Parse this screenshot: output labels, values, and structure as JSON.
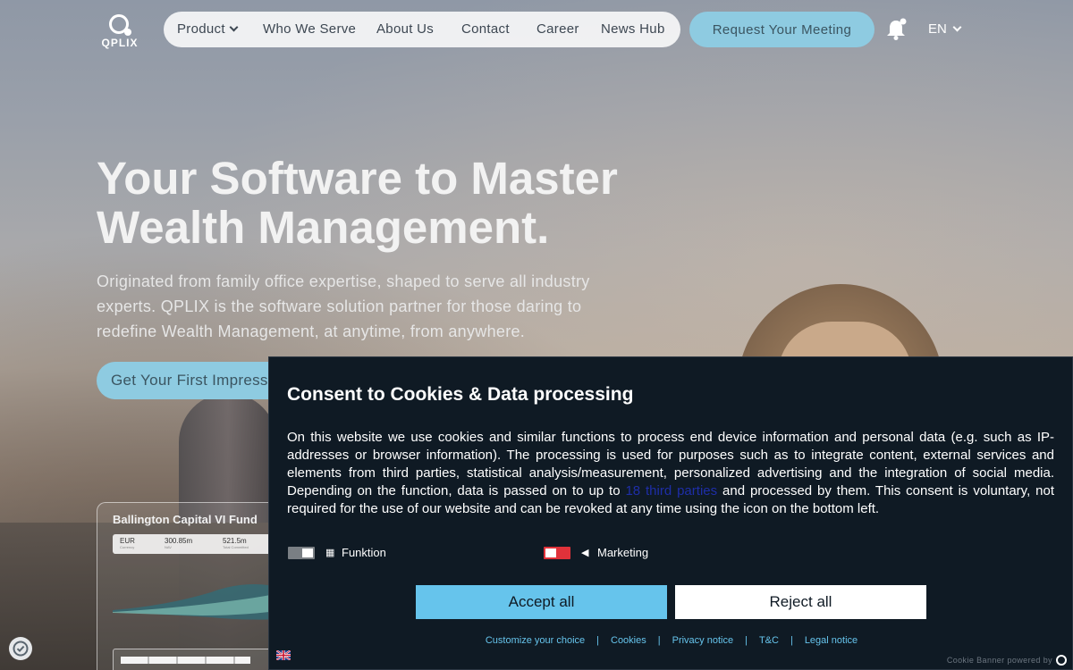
{
  "nav": {
    "logo_text": "QPLIX",
    "items": [
      {
        "label": "Product",
        "has_dropdown": true
      },
      {
        "label": "Who We Serve"
      },
      {
        "label": "About Us"
      },
      {
        "label": "Contact"
      },
      {
        "label": "Career"
      },
      {
        "label": "News Hub"
      }
    ],
    "meeting_button": "Request Your Meeting",
    "language": "EN"
  },
  "hero": {
    "title": "Your Software to Master Wealth Management.",
    "subtitle": "Originated from family office expertise, shaped to serve all industry experts. QPLIX is the software solution partner for those daring to redefine Wealth Management, at anytime, from anywhere.",
    "cta": "Get Your First Impression"
  },
  "fund_card": {
    "title": "Ballington Capital VI Fund",
    "stats": [
      {
        "value": "EUR",
        "label": "Currency"
      },
      {
        "value": "300.85m",
        "label": "NAV"
      },
      {
        "value": "521.5m",
        "label": "Total Committed"
      }
    ]
  },
  "cookie_banner": {
    "title": "Consent to Cookies & Data processing",
    "text_before_link": "On this website we use cookies and similar functions to process end device information and personal data (e.g. such as IP-addresses or browser information). The processing is used for purposes such as to integrate content, external services and elements from third parties, statistical analysis/measurement, personalized advertising and the integration of social media. Depending on the function, data is passed on to up to ",
    "link_text": "18 third parties",
    "text_after_link": " and processed by them. This consent is voluntary, not required for the use of our website and can be revoked at any time using the icon on the bottom left.",
    "toggles": [
      {
        "label": "Funktion",
        "icon": "grid-icon",
        "enabled": true,
        "color": "#7a7f84"
      },
      {
        "label": "Marketing",
        "icon": "megaphone-icon",
        "enabled": false,
        "color": "#e0323a"
      }
    ],
    "accept_label": "Accept all",
    "reject_label": "Reject all",
    "links": [
      "Customize your choice",
      "Cookies",
      "Privacy notice",
      "T&C",
      "Legal notice"
    ],
    "powered_by": "Cookie Banner powered by"
  },
  "colors": {
    "accent": "#8ecbe1",
    "banner_bg": "#0f1a24",
    "accept_bg": "#66c4ec"
  }
}
